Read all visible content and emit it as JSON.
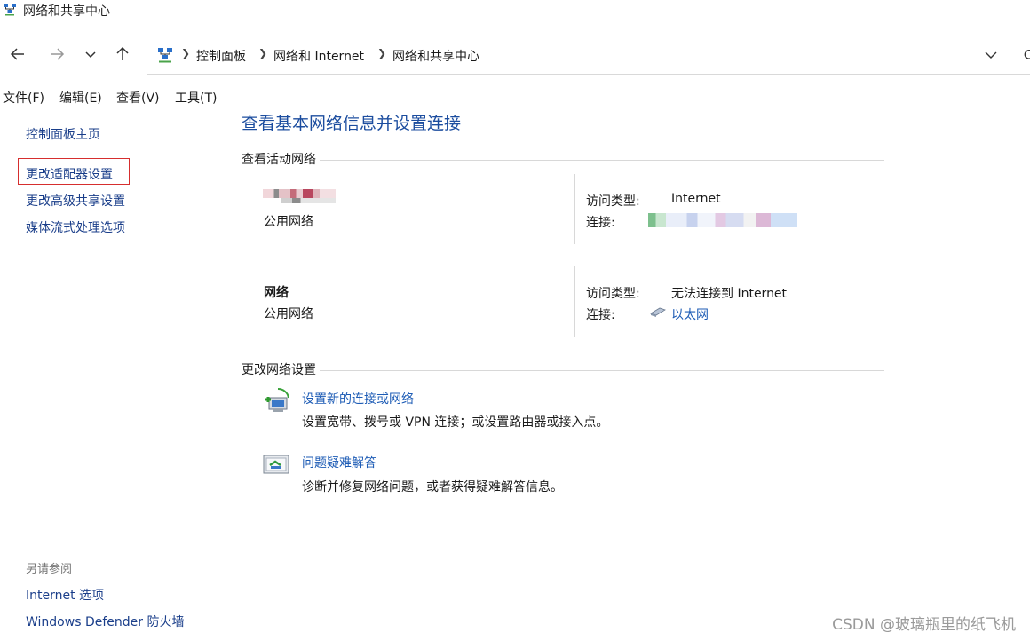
{
  "window": {
    "title": "网络和共享中心",
    "icon": "network-center-icon"
  },
  "address_bar": {
    "icon": "control-panel-icon",
    "crumbs": [
      "控制面板",
      "网络和 Internet",
      "网络和共享中心"
    ]
  },
  "menu": [
    "文件(F)",
    "编辑(E)",
    "查看(V)",
    "工具(T)"
  ],
  "left_pane": {
    "links": [
      "控制面板主页",
      "更改适配器设置",
      "更改高级共享设置",
      "媒体流式处理选项"
    ],
    "highlighted": "更改适配器设置",
    "see_also_title": "另请参阅",
    "see_also": [
      "Internet 选项",
      "Windows Defender 防火墙"
    ]
  },
  "main": {
    "heading": "查看基本网络信息并设置连接",
    "active_networks_title": "查看活动网络",
    "networks": [
      {
        "name": "",
        "type": "公用网络",
        "access_label": "访问类型:",
        "access": "Internet",
        "conn_label": "连接:",
        "conn": ""
      },
      {
        "name": "网络",
        "type": "公用网络",
        "access_label": "访问类型:",
        "access": "无法连接到 Internet",
        "conn_label": "连接:",
        "conn": "以太网"
      }
    ],
    "change_settings_title": "更改网络设置",
    "tasks": [
      {
        "icon": "new-connection-icon",
        "title": "设置新的连接或网络",
        "desc": "设置宽带、拨号或 VPN 连接；或设置路由器或接入点。"
      },
      {
        "icon": "troubleshoot-icon",
        "title": "问题疑难解答",
        "desc": "诊断并修复网络问题，或者获得疑难解答信息。"
      }
    ]
  },
  "watermark": "CSDN @玻璃瓶里的纸飞机",
  "colors": {
    "link": "#1c5bb5",
    "heading": "#1c4d9f",
    "highlight_box": "#d62e2e"
  }
}
